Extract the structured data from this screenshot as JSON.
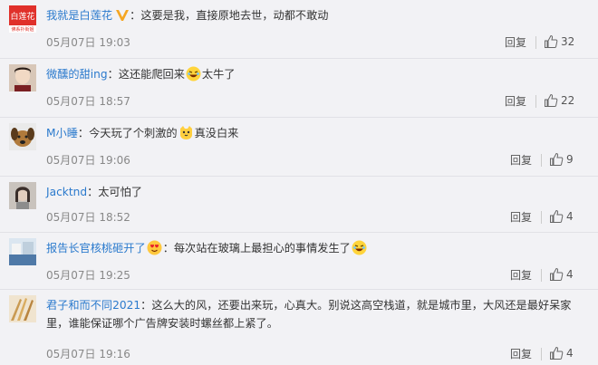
{
  "comments": [
    {
      "username": "我就是白莲花",
      "separator": "：",
      "text": "这要是我，直接原地去世，动都不敢动",
      "time": "05月07日 19:03",
      "reply_label": "回复",
      "likes": "32",
      "avatar_lines": [
        "白莲花",
        "佛系扑街姐"
      ]
    },
    {
      "username": "微醺的甜ing",
      "separator": "：",
      "text": "这还能爬回来",
      "text_after": "太牛了",
      "time": "05月07日 18:57",
      "reply_label": "回复",
      "likes": "22"
    },
    {
      "username": "M小睡",
      "separator": "：",
      "text": "今天玩了个刺激的",
      "text_after": "真没白来",
      "time": "05月07日 19:06",
      "reply_label": "回复",
      "likes": "9"
    },
    {
      "username": "Jacktnd",
      "separator": "：",
      "text": "太可怕了",
      "time": "05月07日 18:52",
      "reply_label": "回复",
      "likes": "4"
    },
    {
      "username": "报告长官核桃砸开了",
      "separator": "：",
      "text": "每次站在玻璃上最担心的事情发生了",
      "time": "05月07日 19:25",
      "reply_label": "回复",
      "likes": "4"
    },
    {
      "username": "君子和而不同2021",
      "separator": "：",
      "text": "这么大的风，还要出来玩，心真大。别说这高空栈道，就是城市里，大风还是最好呆家里，谁能保证哪个广告牌安装时螺丝都上紧了。",
      "time": "05月07日 19:16",
      "reply_label": "回复",
      "likes": "4"
    }
  ],
  "colors": {
    "background": "#f2f2f5",
    "username": "#2b7acd",
    "time": "#888888",
    "vip_badge": "#f5a623"
  },
  "icons": [
    "thumbs-up-icon",
    "vip-badge-icon",
    "laughing-emoji-icon",
    "cat-emoji-icon",
    "heart-eyes-emoji-icon"
  ]
}
